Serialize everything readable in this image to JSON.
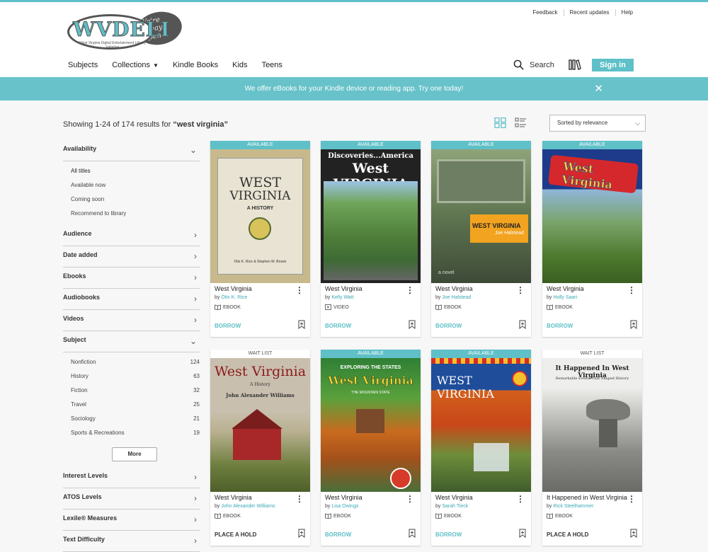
{
  "header": {
    "utility_links": [
      "Feedback",
      "Recent updates",
      "Help"
    ],
    "logo": {
      "text": "WVDELI",
      "tagline": "We're Always Open",
      "subtitle": "West Virginia Digital Entertainment Library Initiative"
    },
    "nav": [
      "Subjects",
      "Collections",
      "Kindle Books",
      "Kids",
      "Teens"
    ],
    "search_label": "Search",
    "signin_label": "Sign in"
  },
  "banner": {
    "text": "We offer eBooks for your Kindle device or reading app. Try one today!",
    "close": "✕"
  },
  "results": {
    "prefix": "Showing 1-24 of 174 results for",
    "query": "“west virginia”"
  },
  "sort": {
    "selected": "Sorted by relevance"
  },
  "sidebar": {
    "availability": {
      "label": "Availability",
      "options": [
        "All titles",
        "Available now",
        "Coming soon",
        "Recommend to library"
      ]
    },
    "sections_a": [
      "Audience",
      "Date added",
      "Ebooks",
      "Audiobooks",
      "Videos"
    ],
    "subject": {
      "label": "Subject",
      "options": [
        {
          "name": "Nonfiction",
          "count": "124"
        },
        {
          "name": "History",
          "count": "63"
        },
        {
          "name": "Fiction",
          "count": "32"
        },
        {
          "name": "Travel",
          "count": "25"
        },
        {
          "name": "Sociology",
          "count": "21"
        },
        {
          "name": "Sports & Recreations",
          "count": "19"
        }
      ],
      "more_label": "More"
    },
    "sections_b": [
      "Interest Levels",
      "ATOS Levels",
      "Lexile® Measures",
      "Text Difficulty"
    ]
  },
  "books": [
    {
      "status": "AVAILABLE",
      "title": "West Virginia",
      "author": "Otis K. Rice",
      "format": "EBOOK",
      "action": "BORROW",
      "cover_text": [
        "WEST",
        "VIRGINIA",
        "A HISTORY",
        "Otis K. Rice & Stephen W. Brown"
      ]
    },
    {
      "status": "AVAILABLE",
      "title": "West Virginia",
      "author": "Kelly Watt",
      "format": "VIDEO",
      "action": "BORROW",
      "cover_text": [
        "Discoveries...America",
        "West VIRGINIA"
      ]
    },
    {
      "status": "AVAILABLE",
      "title": "West Virginia",
      "author": "Joe Halstead",
      "format": "EBOOK",
      "action": "BORROW",
      "cover_text": [
        "WEST VIRGINIA",
        "Joe Halstead",
        "a novel"
      ]
    },
    {
      "status": "AVAILABLE",
      "title": "West Virginia",
      "author": "Holly Saari",
      "format": "EBOOK",
      "action": "BORROW",
      "cover_text": [
        "West Virginia"
      ]
    },
    {
      "status": "WAIT LIST",
      "title": "West Virginia",
      "author": "John Alexander Williams",
      "format": "EBOOK",
      "action": "PLACE A HOLD",
      "cover_text": [
        "West Virginia",
        "A History",
        "John Alexander Williams"
      ]
    },
    {
      "status": "AVAILABLE",
      "title": "West Virginia",
      "author": "Lisa Owings",
      "format": "EBOOK",
      "action": "BORROW",
      "cover_text": [
        "EXPLORING THE STATES",
        "West Virginia",
        "THE MOUNTAIN STATE"
      ]
    },
    {
      "status": "AVAILABLE",
      "title": "West Virginia",
      "author": "Sarah Tieck",
      "format": "EBOOK",
      "action": "BORROW",
      "cover_text": [
        "WEST VIRGINIA"
      ]
    },
    {
      "status": "WAIT LIST",
      "title": "It Happened in West Virginia",
      "author": "Rick Steelhammer",
      "format": "EBOOK",
      "action": "PLACE A HOLD",
      "cover_text": [
        "It Happened In West Virginia",
        "Remarkable Events That Shaped History"
      ]
    }
  ],
  "colors": {
    "accent": "#5fc0c8",
    "banner": "#67c2c9"
  }
}
